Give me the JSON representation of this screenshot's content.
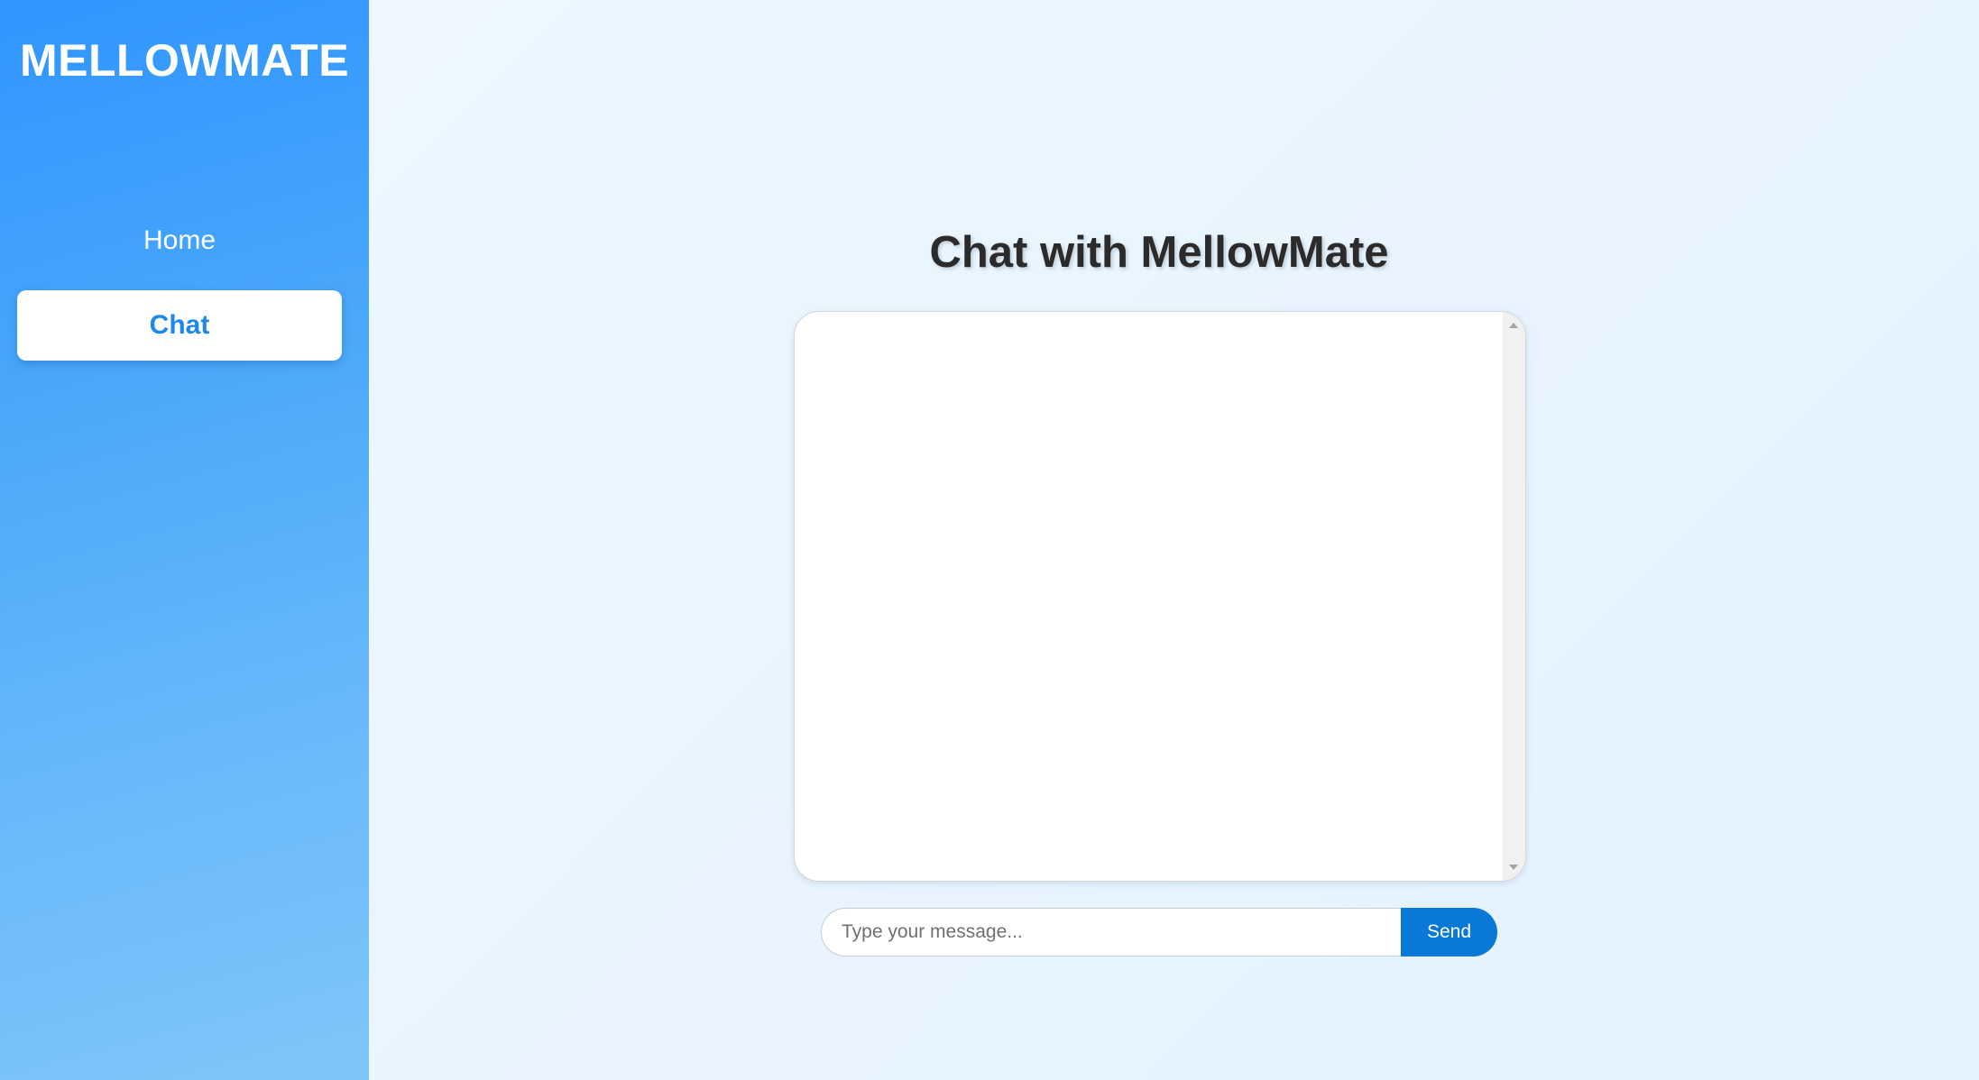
{
  "sidebar": {
    "brand": "MELLOWMATE",
    "items": [
      {
        "label": "Home",
        "active": false
      },
      {
        "label": "Chat",
        "active": true
      }
    ]
  },
  "main": {
    "title": "Chat with MellowMate",
    "chat_messages": [],
    "input": {
      "value": "",
      "placeholder": "Type your message..."
    },
    "send_label": "Send"
  },
  "colors": {
    "sidebar_top": "#2f95ff",
    "sidebar_bottom": "#7fc6fa",
    "active_item_text": "#1e88ec",
    "send_button": "#0a78d6",
    "background": "#eaf6ff"
  }
}
